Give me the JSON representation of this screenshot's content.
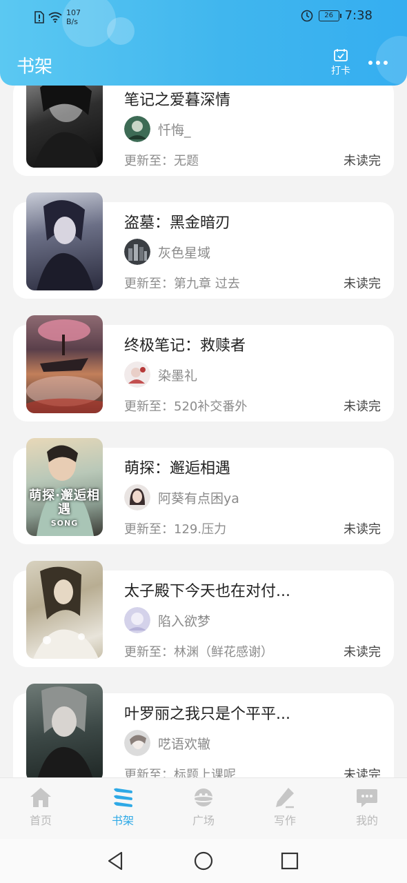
{
  "status_bar": {
    "speed_value": "107",
    "speed_unit": "B/s",
    "battery": "26",
    "time": "7:38"
  },
  "header": {
    "title": "书架",
    "checkin_label": "打卡"
  },
  "books": [
    {
      "title": "笔记之爱暮深情",
      "author": "忏悔_",
      "update": "更新至：无题",
      "status": "未读完"
    },
    {
      "title": "盗墓：黑金暗刃",
      "author": "灰色星域",
      "update": "更新至：第九章  过去",
      "status": "未读完"
    },
    {
      "title": "终极笔记：救赎者",
      "author": "染墨礼",
      "update": "更新至：520补交番外",
      "status": "未读完"
    },
    {
      "title": "萌探：邂逅相遇",
      "author": "阿葵有点困ya",
      "update": "更新至：129.压力",
      "status": "未读完",
      "cover_text": "萌探·邂逅相遇",
      "cover_sub": "SONG"
    },
    {
      "title": "太子殿下今天也在对付...",
      "author": "陷入欲梦",
      "update": "更新至：林渊（鲜花感谢）",
      "status": "未读完"
    },
    {
      "title": "叶罗丽之我只是个平平...",
      "author": "呓语欢辙",
      "update": "更新至：标题上课呢",
      "status": "未读完"
    }
  ],
  "bottom_nav": [
    {
      "label": "首页",
      "icon": "home-icon",
      "active": false
    },
    {
      "label": "书架",
      "icon": "bookshelf-icon",
      "active": true
    },
    {
      "label": "广场",
      "icon": "planet-icon",
      "active": false
    },
    {
      "label": "写作",
      "icon": "pen-icon",
      "active": false
    },
    {
      "label": "我的",
      "icon": "chat-bubble-icon",
      "active": false
    }
  ],
  "colors": {
    "header_gradient_start": "#5bc8f2",
    "header_gradient_end": "#35aef0",
    "active_nav": "#2ea9e6",
    "inactive_nav": "#b9b9b9"
  }
}
